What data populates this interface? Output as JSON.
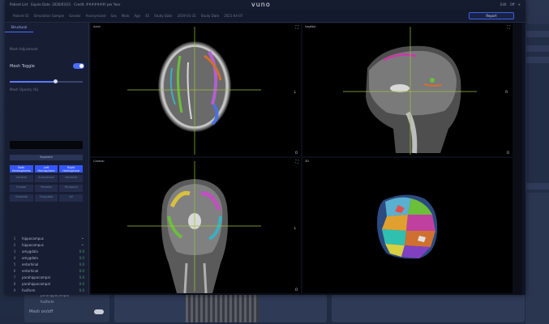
{
  "topbar": {
    "left_items": [
      "Patient List",
      "Expire Date: 2026/03/31",
      "Credit: #######/ per Year"
    ],
    "brand": "vuno",
    "right_items": [
      "Edit",
      "Off",
      "✕"
    ]
  },
  "subbar": {
    "fields": [
      "Patient ID",
      "Simulation Sample",
      "Gender",
      "Anonymized",
      "Sex",
      "Male",
      "Age",
      "45",
      "Study Date",
      "2019-01-31",
      "Study Date",
      "2021-04-07"
    ],
    "report_button": "Report"
  },
  "sidebar": {
    "tabs": [
      "Structural",
      "",
      ""
    ],
    "section_label": "Mesh Adjustment",
    "mesh_toggle_label": "Mesh Toggle",
    "mesh_toggle_on": true,
    "opacity_value": 0.62,
    "opacity_label": "Mesh Opacity (%)",
    "segment_button": "Segment",
    "grid_buttons": [
      {
        "label": "Both Hemispheres",
        "on": true
      },
      {
        "label": "Left Hemisphere",
        "on": true
      },
      {
        "label": "Right Hemisphere",
        "on": true
      },
      {
        "label": "Cortical",
        "on": false
      },
      {
        "label": "Subcortical",
        "on": false
      },
      {
        "label": "Ventricle",
        "on": false
      },
      {
        "label": "Frontal",
        "on": false
      },
      {
        "label": "Parietal",
        "on": false
      },
      {
        "label": "Temporal",
        "on": false
      },
      {
        "label": "Occipital",
        "on": false
      },
      {
        "label": "Cingulate",
        "on": false
      },
      {
        "label": "All",
        "on": false
      }
    ],
    "structures": [
      {
        "idx": "1",
        "name": "hippocampus",
        "val": "",
        "chevron": true
      },
      {
        "idx": "2",
        "name": "hippocampus",
        "val": "",
        "chevron": true
      },
      {
        "idx": "3",
        "name": "amygdala",
        "val": "0.0",
        "chevron": false
      },
      {
        "idx": "4",
        "name": "amygdala",
        "val": "0.0",
        "chevron": false
      },
      {
        "idx": "5",
        "name": "entorhinal",
        "val": "0.0",
        "chevron": false
      },
      {
        "idx": "6",
        "name": "entorhinal",
        "val": "0.0",
        "chevron": false
      },
      {
        "idx": "7",
        "name": "parahippocampal",
        "val": "0.0",
        "chevron": false
      },
      {
        "idx": "8",
        "name": "parahippocampal",
        "val": "0.0",
        "chevron": false
      },
      {
        "idx": "9",
        "name": "fusiform",
        "val": "0.0",
        "chevron": false
      }
    ]
  },
  "viewports": {
    "axial": {
      "title": "Axial",
      "side": "L",
      "bottom": "O"
    },
    "sagittal": {
      "title": "Sagittal",
      "side": "R",
      "bottom": "O"
    },
    "coronal": {
      "title": "Coronal",
      "side": "L",
      "bottom": "O"
    },
    "three_d": {
      "title": "3D"
    }
  },
  "background": {
    "list_items": [
      "parahippocampal",
      "fusiform"
    ],
    "toggle_label": "Mesh on/off"
  },
  "colors": {
    "accent": "#4a6cff",
    "crosshair": "#9ec040",
    "app_bg": "#0f1526"
  }
}
